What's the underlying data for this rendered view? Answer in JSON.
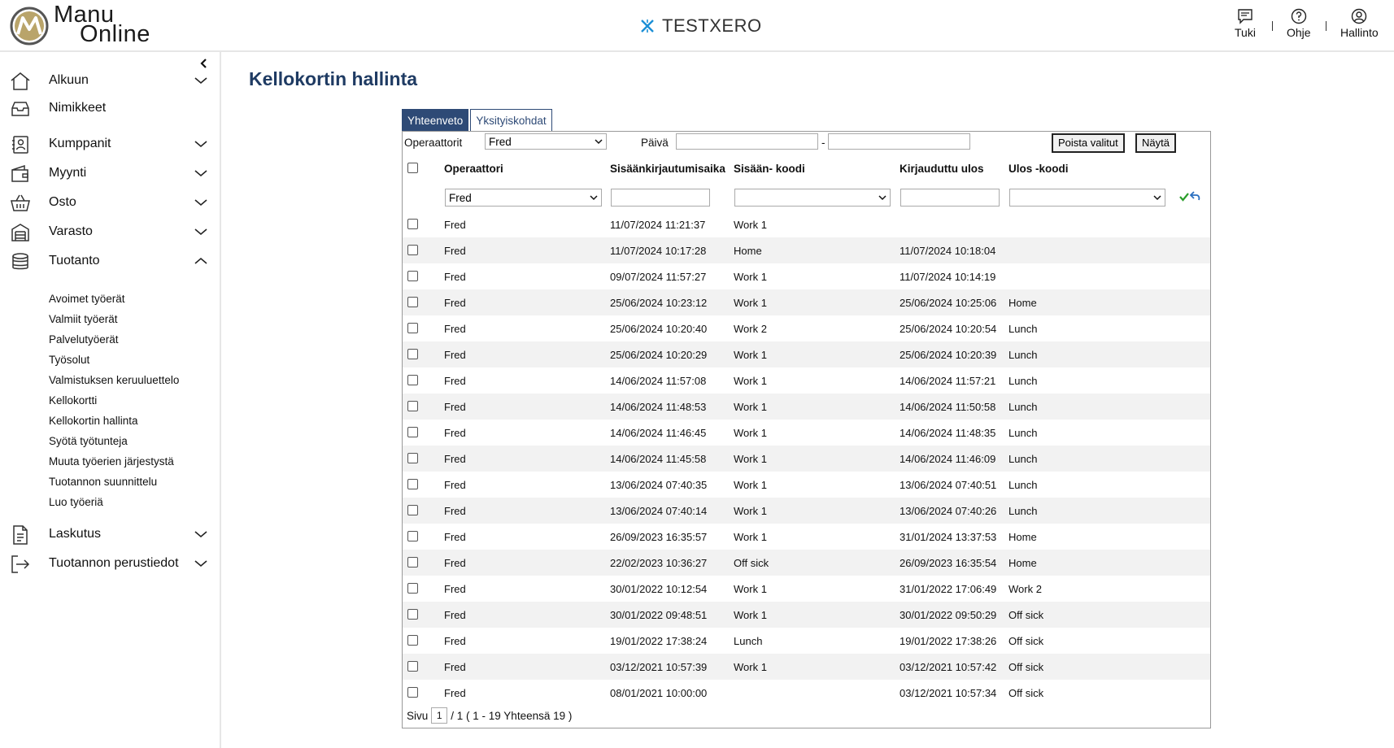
{
  "brand": {
    "name_line1": "Manu",
    "name_line2": "Online"
  },
  "company": {
    "name": "TESTXERO"
  },
  "top_actions": {
    "support": "Tuki",
    "help": "Ohje",
    "admin": "Hallinto"
  },
  "sidebar": {
    "items": [
      {
        "label": "Alkuun",
        "icon": "home-icon",
        "expandable": true
      },
      {
        "label": "Nimikkeet",
        "icon": "inbox-icon",
        "expandable": false
      },
      {
        "label": "Kumppanit",
        "icon": "contacts-icon",
        "expandable": true
      },
      {
        "label": "Myynti",
        "icon": "wallet-icon",
        "expandable": true
      },
      {
        "label": "Osto",
        "icon": "basket-icon",
        "expandable": true
      },
      {
        "label": "Varasto",
        "icon": "warehouse-icon",
        "expandable": true
      },
      {
        "label": "Tuotanto",
        "icon": "database-icon",
        "expanded": true
      },
      {
        "label": "Laskutus",
        "icon": "document-icon",
        "expandable": true
      },
      {
        "label": "Tuotannon perustiedot",
        "icon": "exit-icon",
        "expandable": true
      }
    ],
    "production_sub": [
      "Avoimet työerät",
      "Valmiit työerät",
      "Palvelutyöerät",
      "Työsolut",
      "Valmistuksen keruuluettelo",
      "Kellokortti",
      "Kellokortin hallinta",
      "Syötä työtunteja",
      "Muuta työerien järjestystä",
      "Tuotannon suunnittelu",
      "Luo työeriä"
    ]
  },
  "page": {
    "title": "Kellokortin hallinta"
  },
  "tabs": [
    "Yhteenveto",
    "Yksityiskohdat"
  ],
  "filters": {
    "operators_label": "Operaattorit",
    "operators_value": "Fred",
    "date_label": "Päivä",
    "date_from": "",
    "date_sep": "-",
    "date_to": "",
    "delete_button": "Poista valitut",
    "show_button": "Näytä"
  },
  "table": {
    "headers": {
      "operator": "Operaattori",
      "login_time": "Sisäänkirjautumisaika",
      "in_code": "Sisään- koodi",
      "logged_out": "Kirjauduttu ulos",
      "out_code": "Ulos -koodi"
    },
    "filter_row": {
      "operator": "Fred",
      "login_time": "",
      "in_code": "",
      "logged_out": "",
      "out_code": ""
    },
    "rows": [
      {
        "operator": "Fred",
        "login": "11/07/2024 11:21:37",
        "in_code": "Work 1",
        "logout": "",
        "out_code": ""
      },
      {
        "operator": "Fred",
        "login": "11/07/2024 10:17:28",
        "in_code": "Home",
        "logout": "11/07/2024 10:18:04",
        "out_code": ""
      },
      {
        "operator": "Fred",
        "login": "09/07/2024 11:57:27",
        "in_code": "Work 1",
        "logout": "11/07/2024 10:14:19",
        "out_code": ""
      },
      {
        "operator": "Fred",
        "login": "25/06/2024 10:23:12",
        "in_code": "Work 1",
        "logout": "25/06/2024 10:25:06",
        "out_code": "Home"
      },
      {
        "operator": "Fred",
        "login": "25/06/2024 10:20:40",
        "in_code": "Work 2",
        "logout": "25/06/2024 10:20:54",
        "out_code": "Lunch"
      },
      {
        "operator": "Fred",
        "login": "25/06/2024 10:20:29",
        "in_code": "Work 1",
        "logout": "25/06/2024 10:20:39",
        "out_code": "Lunch"
      },
      {
        "operator": "Fred",
        "login": "14/06/2024 11:57:08",
        "in_code": "Work 1",
        "logout": "14/06/2024 11:57:21",
        "out_code": "Lunch"
      },
      {
        "operator": "Fred",
        "login": "14/06/2024 11:48:53",
        "in_code": "Work 1",
        "logout": "14/06/2024 11:50:58",
        "out_code": "Lunch"
      },
      {
        "operator": "Fred",
        "login": "14/06/2024 11:46:45",
        "in_code": "Work 1",
        "logout": "14/06/2024 11:48:35",
        "out_code": "Lunch"
      },
      {
        "operator": "Fred",
        "login": "14/06/2024 11:45:58",
        "in_code": "Work 1",
        "logout": "14/06/2024 11:46:09",
        "out_code": "Lunch"
      },
      {
        "operator": "Fred",
        "login": "13/06/2024 07:40:35",
        "in_code": "Work 1",
        "logout": "13/06/2024 07:40:51",
        "out_code": "Lunch"
      },
      {
        "operator": "Fred",
        "login": "13/06/2024 07:40:14",
        "in_code": "Work 1",
        "logout": "13/06/2024 07:40:26",
        "out_code": "Lunch"
      },
      {
        "operator": "Fred",
        "login": "26/09/2023 16:35:57",
        "in_code": "Work 1",
        "logout": "31/01/2024 13:37:53",
        "out_code": "Home"
      },
      {
        "operator": "Fred",
        "login": "22/02/2023 10:36:27",
        "in_code": "Off sick",
        "logout": "26/09/2023 16:35:54",
        "out_code": "Home"
      },
      {
        "operator": "Fred",
        "login": "30/01/2022 10:12:54",
        "in_code": "Work 1",
        "logout": "31/01/2022 17:06:49",
        "out_code": "Work 2"
      },
      {
        "operator": "Fred",
        "login": "30/01/2022 09:48:51",
        "in_code": "Work 1",
        "logout": "30/01/2022 09:50:29",
        "out_code": "Off sick"
      },
      {
        "operator": "Fred",
        "login": "19/01/2022 17:38:24",
        "in_code": "Lunch",
        "logout": "19/01/2022 17:38:26",
        "out_code": "Off sick"
      },
      {
        "operator": "Fred",
        "login": "03/12/2021 10:57:39",
        "in_code": "Work 1",
        "logout": "03/12/2021 10:57:42",
        "out_code": "Off sick"
      },
      {
        "operator": "Fred",
        "login": "08/01/2021 10:00:00",
        "in_code": "",
        "logout": "03/12/2021 10:57:34",
        "out_code": "Off sick"
      }
    ]
  },
  "pager": {
    "prefix": "Sivu",
    "page": "1",
    "summary": "/ 1 ( 1 - 19 Yhteensä 19 )"
  },
  "colors": {
    "title": "#1f3b63",
    "tab_active": "#2e4a76",
    "row_alt": "#f2f2f2",
    "accept": "#2a9d2a",
    "undo": "#2a6fc0"
  }
}
